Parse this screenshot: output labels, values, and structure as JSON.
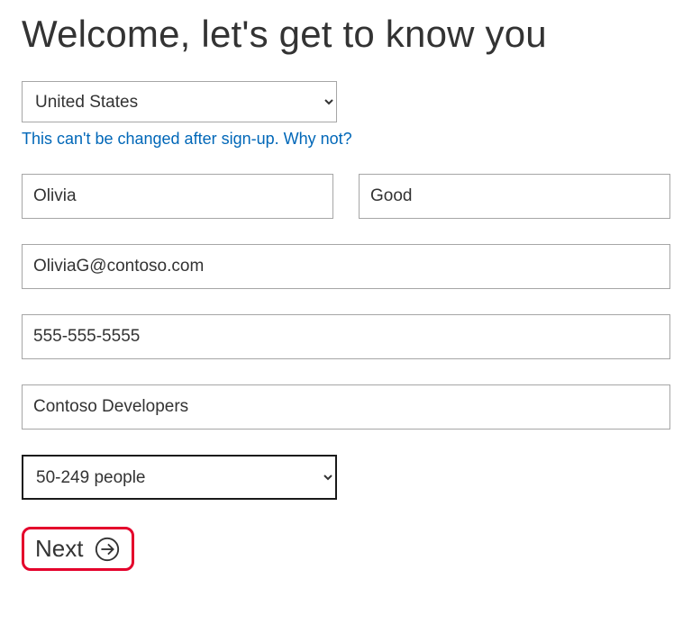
{
  "title": "Welcome, let's get to know you",
  "country": {
    "selected": "United States",
    "helper_text": "This can't be changed after sign-up. Why not?"
  },
  "name": {
    "first": "Olivia",
    "last": "Good"
  },
  "email": "OliviaG@contoso.com",
  "phone": "555-555-5555",
  "company": "Contoso Developers",
  "size": {
    "selected": "50-249 people"
  },
  "next_label": "Next"
}
